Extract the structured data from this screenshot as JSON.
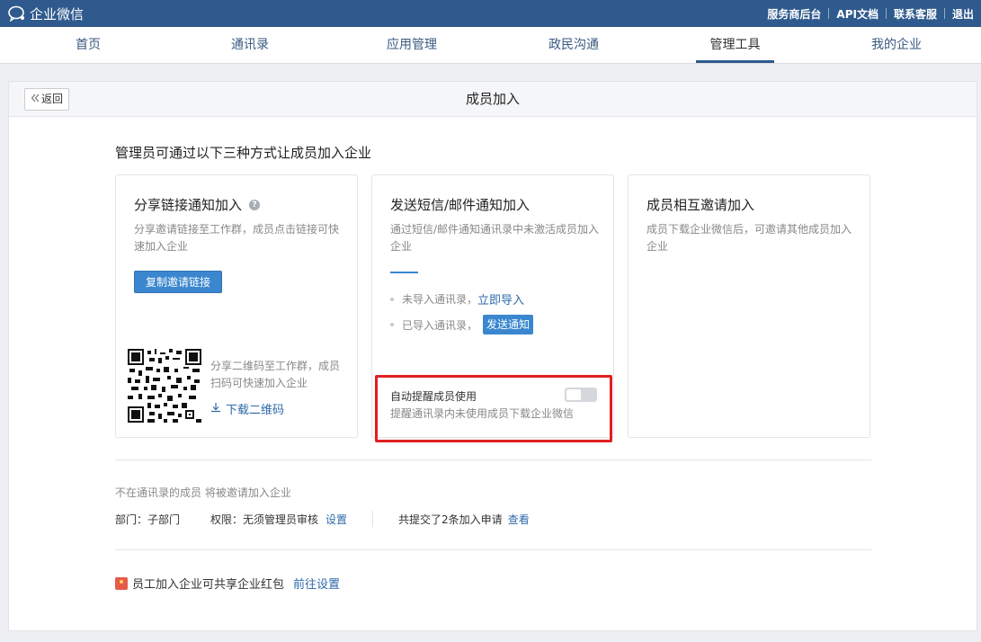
{
  "topbar": {
    "app_name": "企业微信",
    "links": [
      "服务商后台",
      "API文档",
      "联系客服",
      "退出"
    ]
  },
  "nav": {
    "items": [
      "首页",
      "通讯录",
      "应用管理",
      "政民沟通",
      "管理工具",
      "我的企业"
    ],
    "active": "管理工具"
  },
  "panel": {
    "back_label": "返回",
    "title": "成员加入",
    "intro": "管理员可通过以下三种方式让成员加入企业"
  },
  "cards": {
    "share": {
      "title": "分享链接通知加入",
      "desc": "分享邀请链接至工作群，成员点击链接可快速加入企业",
      "copy_button": "复制邀请链接",
      "qr_desc": "分享二维码至工作群，成员扫码可快速加入企业",
      "download_qr": "下载二维码"
    },
    "sms": {
      "title": "发送短信/邮件通知加入",
      "desc": "通过短信/邮件通知通讯录中未激活成员加入企业",
      "not_imported": "未导入通讯录，",
      "import_now": "立即导入",
      "imported": "已导入通讯录，",
      "send_notice": "发送通知",
      "auto_remind_title": "自动提醒成员使用",
      "auto_remind_desc": "提醒通讯录内未使用成员下载企业微信",
      "auto_remind_on": false
    },
    "invite": {
      "title": "成员相互邀请加入",
      "desc": "成员下载企业微信后，可邀请其他成员加入企业"
    }
  },
  "settings": {
    "note": "不在通讯录的成员 将被邀请加入企业",
    "dept": "部门：子部门",
    "permission": "权限：无须管理员审核",
    "permission_link": "设置",
    "applications": "共提交了2条加入申请",
    "applications_link": "查看"
  },
  "redpack": {
    "text": "员工加入企业可共享企业红包",
    "link": "前往设置"
  },
  "colors": {
    "topbar": "#2f5a8d",
    "accent": "#3a87cf",
    "highlight": "#e02020"
  }
}
